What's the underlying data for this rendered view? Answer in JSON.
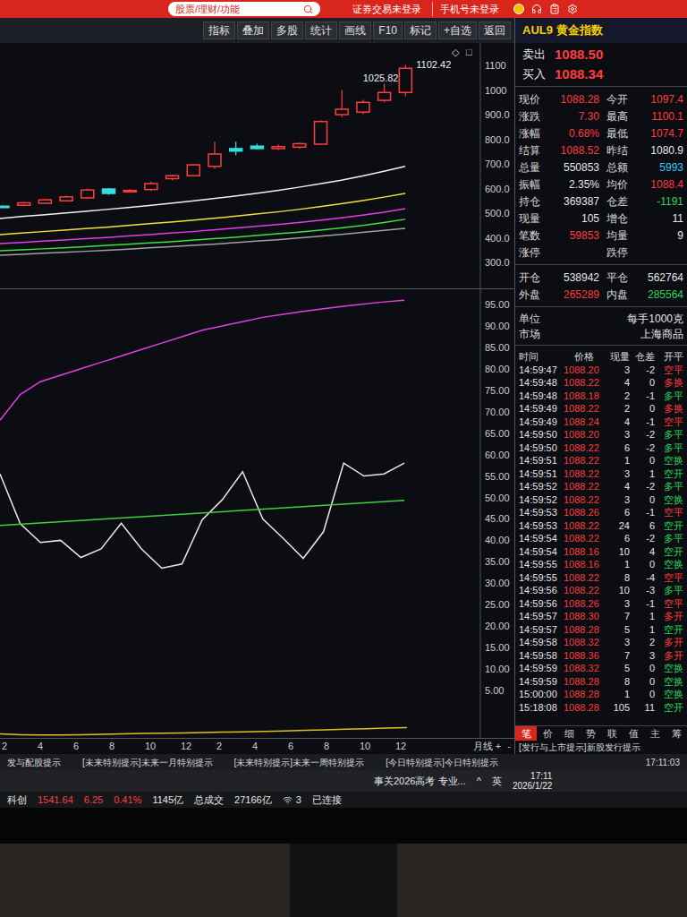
{
  "top_bar": {
    "search": {
      "placeholder": "股票/理财/功能"
    },
    "status": [
      "证券交易未登录",
      "手机号未登录"
    ]
  },
  "toolbar": [
    "指标",
    "叠加",
    "多股",
    "统计",
    "画线",
    "F10",
    "标记",
    "+自选",
    "返回"
  ],
  "price_chart": {
    "corner_marks": [
      "◇",
      "□"
    ],
    "y_ticks": [
      "1100",
      "1000",
      "900.0",
      "800.0",
      "700.0",
      "600.0",
      "500.0",
      "400.0",
      "300.0"
    ],
    "candles": [
      [
        528,
        532,
        522,
        526
      ],
      [
        532,
        546,
        528,
        542
      ],
      [
        540,
        558,
        536,
        554
      ],
      [
        550,
        572,
        546,
        566
      ],
      [
        562,
        600,
        556,
        594
      ],
      [
        598,
        602,
        574,
        580
      ],
      [
        590,
        598,
        586,
        592
      ],
      [
        596,
        628,
        590,
        620
      ],
      [
        640,
        656,
        634,
        652
      ],
      [
        652,
        700,
        648,
        696
      ],
      [
        690,
        790,
        680,
        740
      ],
      [
        762,
        790,
        735,
        752
      ],
      [
        772,
        782,
        758,
        762
      ],
      [
        762,
        778,
        756,
        770
      ],
      [
        768,
        786,
        762,
        782
      ],
      [
        780,
        878,
        776,
        872
      ],
      [
        900,
        1000,
        890,
        922
      ],
      [
        910,
        960,
        902,
        950
      ],
      [
        958,
        1025.82,
        950,
        990
      ],
      [
        990,
        1102.42,
        975,
        1088.28
      ]
    ],
    "annotations": [
      {
        "label": "1025.82",
        "index": 18,
        "value": 1025.82
      },
      {
        "label": "1102.42",
        "index": 19,
        "value": 1102.42
      }
    ],
    "moving_averages": [
      {
        "color": "#f2f2f2",
        "values": [
          478,
          486,
          493,
          500,
          507,
          515,
          523,
          531,
          540,
          549,
          559,
          569,
          580,
          592,
          605,
          619,
          634,
          651,
          670,
          690
        ]
      },
      {
        "color": "#f0e040",
        "values": [
          413,
          419,
          425,
          431,
          437,
          443,
          450,
          457,
          464,
          471,
          479,
          487,
          496,
          505,
          515,
          526,
          538,
          551,
          565,
          580
        ]
      },
      {
        "color": "#e040e0",
        "values": [
          376,
          381,
          386,
          391,
          396,
          401,
          407,
          413,
          419,
          425,
          432,
          439,
          446,
          454,
          462,
          471,
          481,
          492,
          504,
          518
        ]
      },
      {
        "color": "#40e040",
        "values": [
          347,
          351,
          355,
          359,
          364,
          369,
          374,
          379,
          384,
          390,
          396,
          402,
          409,
          416,
          423,
          431,
          440,
          450,
          462,
          475
        ]
      },
      {
        "color": "#a0a0a0",
        "values": [
          329,
          333,
          337,
          341,
          345,
          349,
          354,
          359,
          364,
          369,
          374,
          380,
          386,
          392,
          399,
          406,
          414,
          422,
          430,
          438
        ]
      }
    ]
  },
  "indicator": {
    "y_ticks": [
      "95.00",
      "90.00",
      "85.00",
      "80.00",
      "75.00",
      "70.00",
      "65.00",
      "60.00",
      "55.00",
      "50.00",
      "45.00",
      "40.00",
      "35.00",
      "30.00",
      "25.00",
      "20.00",
      "15.00",
      "10.00",
      "5.00"
    ],
    "series": [
      {
        "color": "#e040e0",
        "values": [
          68,
          74,
          77,
          78.5,
          80,
          81.5,
          83,
          84.5,
          86,
          87.5,
          89,
          90,
          91,
          92,
          92.7,
          93.4,
          94,
          94.6,
          95.1,
          95.6,
          96
        ]
      },
      {
        "color": "#e8e8e8",
        "values": [
          55.5,
          43.9,
          39.5,
          40,
          36,
          38,
          44,
          38,
          33.5,
          34.5,
          44.8,
          49.5,
          56,
          45,
          40.5,
          35.8,
          42,
          58,
          55,
          55.5,
          58
        ]
      },
      {
        "color": "#40d040",
        "values": [
          43.5,
          49.3
        ]
      }
    ]
  },
  "volume": {
    "color": "#e0c020",
    "values": [
      0.15,
      0.1,
      0.08,
      0.08,
      0.1,
      0.12,
      0.15,
      0.18,
      0.2,
      0.22,
      0.25,
      0.28,
      0.3,
      0.33,
      0.36,
      0.4,
      0.44,
      0.48,
      0.52,
      0.56,
      0.6
    ]
  },
  "x_axis": {
    "labels": [
      "2",
      "4",
      "6",
      "8",
      "10",
      "12",
      "2",
      "4",
      "6",
      "8",
      "10",
      "12"
    ],
    "period": "月线",
    "zoom": [
      "+",
      "-"
    ]
  },
  "quote": {
    "title": "AUL9 黄金指数",
    "bid_ask": [
      {
        "label": "卖出",
        "value": "1088.50"
      },
      {
        "label": "买入",
        "value": "1088.34"
      }
    ],
    "fields": [
      {
        "label": "现价",
        "value": "1088.28",
        "color": "#ff3c3c",
        "label2": "今开",
        "value2": "1097.4",
        "color2": "#ff3c3c"
      },
      {
        "label": "涨跌",
        "value": "7.30",
        "color": "#ff3c3c",
        "label2": "最高",
        "value2": "1100.1",
        "color2": "#ff3c3c"
      },
      {
        "label": "涨幅",
        "value": "0.68%",
        "color": "#ff3c3c",
        "label2": "最低",
        "value2": "1074.7",
        "color2": "#ff3c3c"
      },
      {
        "label": "结算",
        "value": "1088.52",
        "color": "#ff3c3c",
        "label2": "昨结",
        "value2": "1080.9",
        "color2": "#e6e6e6"
      },
      {
        "label": "总量",
        "value": "550853",
        "color": "#e6e6e6",
        "label2": "总额",
        "value2": "5993",
        "color2": "#35c9ff"
      },
      {
        "label": "振幅",
        "value": "2.35%",
        "color": "#e6e6e6",
        "label2": "均价",
        "value2": "1088.4",
        "color2": "#ff3c3c"
      },
      {
        "label": "持仓",
        "value": "369387",
        "color": "#e6e6e6",
        "label2": "仓差",
        "value2": "-1191",
        "color2": "#2fd35a"
      },
      {
        "label": "现量",
        "value": "105",
        "color": "#e6e6e6",
        "label2": "增仓",
        "value2": "11",
        "color2": "#e6e6e6"
      },
      {
        "label": "笔数",
        "value": "59853",
        "color": "#ff3c3c",
        "label2": "均量",
        "value2": "9",
        "color2": "#e6e6e6"
      },
      {
        "label": "涨停",
        "value": "",
        "color": "#ff3c3c",
        "label2": "跌停",
        "value2": "",
        "color2": "#2fd35a"
      }
    ],
    "flow": [
      {
        "label": "开仓",
        "value": "538942",
        "color": "#e6e6e6",
        "label2": "平仓",
        "value2": "562764",
        "color2": "#e6e6e6"
      },
      {
        "label": "外盘",
        "value": "265289",
        "color": "#ff3c3c",
        "label2": "内盘",
        "value2": "285564",
        "color2": "#2fd35a"
      }
    ],
    "info": [
      {
        "label": "单位",
        "value": "每手1000克"
      },
      {
        "label": "市场",
        "value": "上海商品"
      }
    ]
  },
  "ticks": {
    "columns": [
      "时间",
      "价格",
      "现量",
      "仓差",
      "开平"
    ],
    "rows": [
      {
        "time": "14:59:47",
        "price": "1088.20",
        "qty": "3",
        "diff": "-2",
        "kind": "空平",
        "color": "#ff3c3c"
      },
      {
        "time": "14:59:48",
        "price": "1088.22",
        "qty": "4",
        "diff": "0",
        "kind": "多换",
        "color": "#ff3c3c"
      },
      {
        "time": "14:59:48",
        "price": "1088.18",
        "qty": "2",
        "diff": "-1",
        "kind": "多平",
        "color": "#2fd35a"
      },
      {
        "time": "14:59:49",
        "price": "1088.22",
        "qty": "2",
        "diff": "0",
        "kind": "多换",
        "color": "#ff3c3c"
      },
      {
        "time": "14:59:49",
        "price": "1088.24",
        "qty": "4",
        "diff": "-1",
        "kind": "空平",
        "color": "#ff3c3c"
      },
      {
        "time": "14:59:50",
        "price": "1088.20",
        "qty": "3",
        "diff": "-2",
        "kind": "多平",
        "color": "#2fd35a"
      },
      {
        "time": "14:59:50",
        "price": "1088.22",
        "qty": "6",
        "diff": "-2",
        "kind": "多平",
        "color": "#2fd35a"
      },
      {
        "time": "14:59:51",
        "price": "1088.22",
        "qty": "1",
        "diff": "0",
        "kind": "空换",
        "color": "#2fd35a"
      },
      {
        "time": "14:59:51",
        "price": "1088.22",
        "qty": "3",
        "diff": "1",
        "kind": "空开",
        "color": "#2fd35a"
      },
      {
        "time": "14:59:52",
        "price": "1088.22",
        "qty": "4",
        "diff": "-2",
        "kind": "多平",
        "color": "#2fd35a"
      },
      {
        "time": "14:59:52",
        "price": "1088.22",
        "qty": "3",
        "diff": "0",
        "kind": "空换",
        "color": "#2fd35a"
      },
      {
        "time": "14:59:53",
        "price": "1088.26",
        "qty": "6",
        "diff": "-1",
        "kind": "空平",
        "color": "#ff3c3c"
      },
      {
        "time": "14:59:53",
        "price": "1088.22",
        "qty": "24",
        "diff": "6",
        "kind": "空开",
        "color": "#2fd35a"
      },
      {
        "time": "14:59:54",
        "price": "1088.22",
        "qty": "6",
        "diff": "-2",
        "kind": "多平",
        "color": "#2fd35a"
      },
      {
        "time": "14:59:54",
        "price": "1088.16",
        "qty": "10",
        "diff": "4",
        "kind": "空开",
        "color": "#2fd35a"
      },
      {
        "time": "14:59:55",
        "price": "1088.16",
        "qty": "1",
        "diff": "0",
        "kind": "空换",
        "color": "#2fd35a"
      },
      {
        "time": "14:59:55",
        "price": "1088.22",
        "qty": "8",
        "diff": "-4",
        "kind": "空平",
        "color": "#ff3c3c"
      },
      {
        "time": "14:59:56",
        "price": "1088.22",
        "qty": "10",
        "diff": "-3",
        "kind": "多平",
        "color": "#2fd35a"
      },
      {
        "time": "14:59:56",
        "price": "1088.26",
        "qty": "3",
        "diff": "-1",
        "kind": "空平",
        "color": "#ff3c3c"
      },
      {
        "time": "14:59:57",
        "price": "1088.30",
        "qty": "7",
        "diff": "1",
        "kind": "多开",
        "color": "#ff3c3c"
      },
      {
        "time": "14:59:57",
        "price": "1088.28",
        "qty": "5",
        "diff": "1",
        "kind": "空开",
        "color": "#2fd35a"
      },
      {
        "time": "14:59:58",
        "price": "1088.32",
        "qty": "3",
        "diff": "2",
        "kind": "多开",
        "color": "#ff3c3c"
      },
      {
        "time": "14:59:58",
        "price": "1088.36",
        "qty": "7",
        "diff": "3",
        "kind": "多开",
        "color": "#ff3c3c"
      },
      {
        "time": "14:59:59",
        "price": "1088.32",
        "qty": "5",
        "diff": "0",
        "kind": "空换",
        "color": "#2fd35a"
      },
      {
        "time": "14:59:59",
        "price": "1088.28",
        "qty": "8",
        "diff": "0",
        "kind": "空换",
        "color": "#2fd35a"
      },
      {
        "time": "15:00:00",
        "price": "1088.28",
        "qty": "1",
        "diff": "0",
        "kind": "空换",
        "color": "#2fd35a"
      },
      {
        "time": "15:18:08",
        "price": "1088.28",
        "qty": "105",
        "diff": "11",
        "kind": "空开",
        "color": "#2fd35a"
      }
    ]
  },
  "side_tabs": [
    {
      "label": "笔",
      "selected": true
    },
    {
      "label": "价",
      "selected": false
    },
    {
      "label": "细",
      "selected": false
    },
    {
      "label": "势",
      "selected": false
    },
    {
      "label": "联",
      "selected": false
    },
    {
      "label": "值",
      "selected": false
    },
    {
      "label": "主",
      "selected": false
    },
    {
      "label": "筹",
      "selected": false
    }
  ],
  "side_news": "[发行与上市提示]新股发行提示",
  "news_bar": {
    "items": [
      "发与配股提示",
      "[未来特别提示]未来一月特别提示",
      "[未来特别提示]未来一周特别提示",
      "[今日特别提示]今日特别提示"
    ],
    "clock": "17:11:03"
  },
  "taskbar": {
    "notification": "事关2026高考 专业...",
    "tray": [
      "^",
      "英"
    ],
    "time": "17:11",
    "date": "2026/1/22"
  },
  "status_bar": [
    {
      "text": "科创",
      "color": "#e6e6e6"
    },
    {
      "text": "1541.64",
      "color": "#ff3c3c"
    },
    {
      "text": "6.25",
      "color": "#ff3c3c"
    },
    {
      "text": "0.41%",
      "color": "#ff3c3c"
    },
    {
      "text": "1145亿",
      "color": "#e6e6e6"
    },
    {
      "text": "总成交",
      "color": "#e6e6e6"
    },
    {
      "text": "27166亿",
      "color": "#e6e6e6"
    },
    {
      "text": "3",
      "color": "#e6e6e6"
    },
    {
      "text": "已连接",
      "color": "#e6e6e6"
    }
  ]
}
